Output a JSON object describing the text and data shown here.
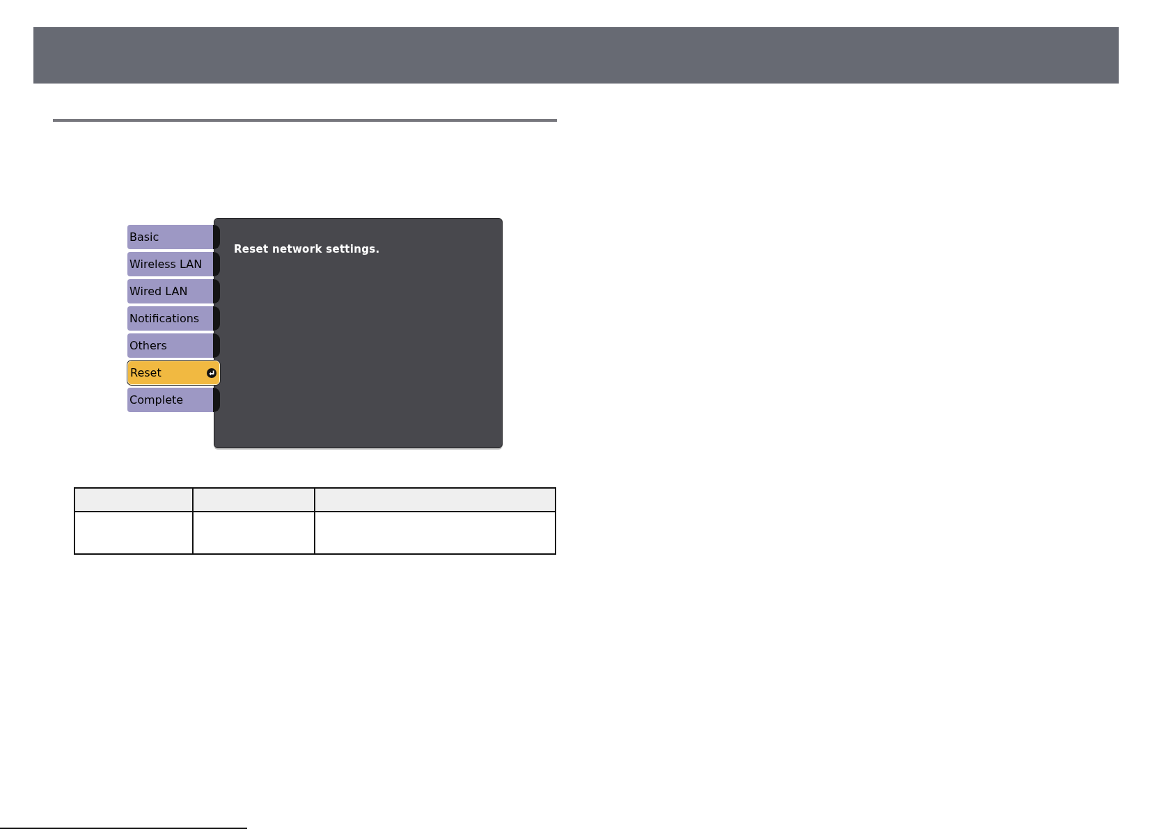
{
  "menu": {
    "items": [
      {
        "label": "Basic",
        "selected": false
      },
      {
        "label": "Wireless LAN",
        "selected": false
      },
      {
        "label": "Wired LAN",
        "selected": false
      },
      {
        "label": "Notifications",
        "selected": false
      },
      {
        "label": "Others",
        "selected": false
      },
      {
        "label": "Reset",
        "selected": true
      },
      {
        "label": "Complete",
        "selected": false
      }
    ]
  },
  "panel": {
    "message": "Reset network settings."
  }
}
